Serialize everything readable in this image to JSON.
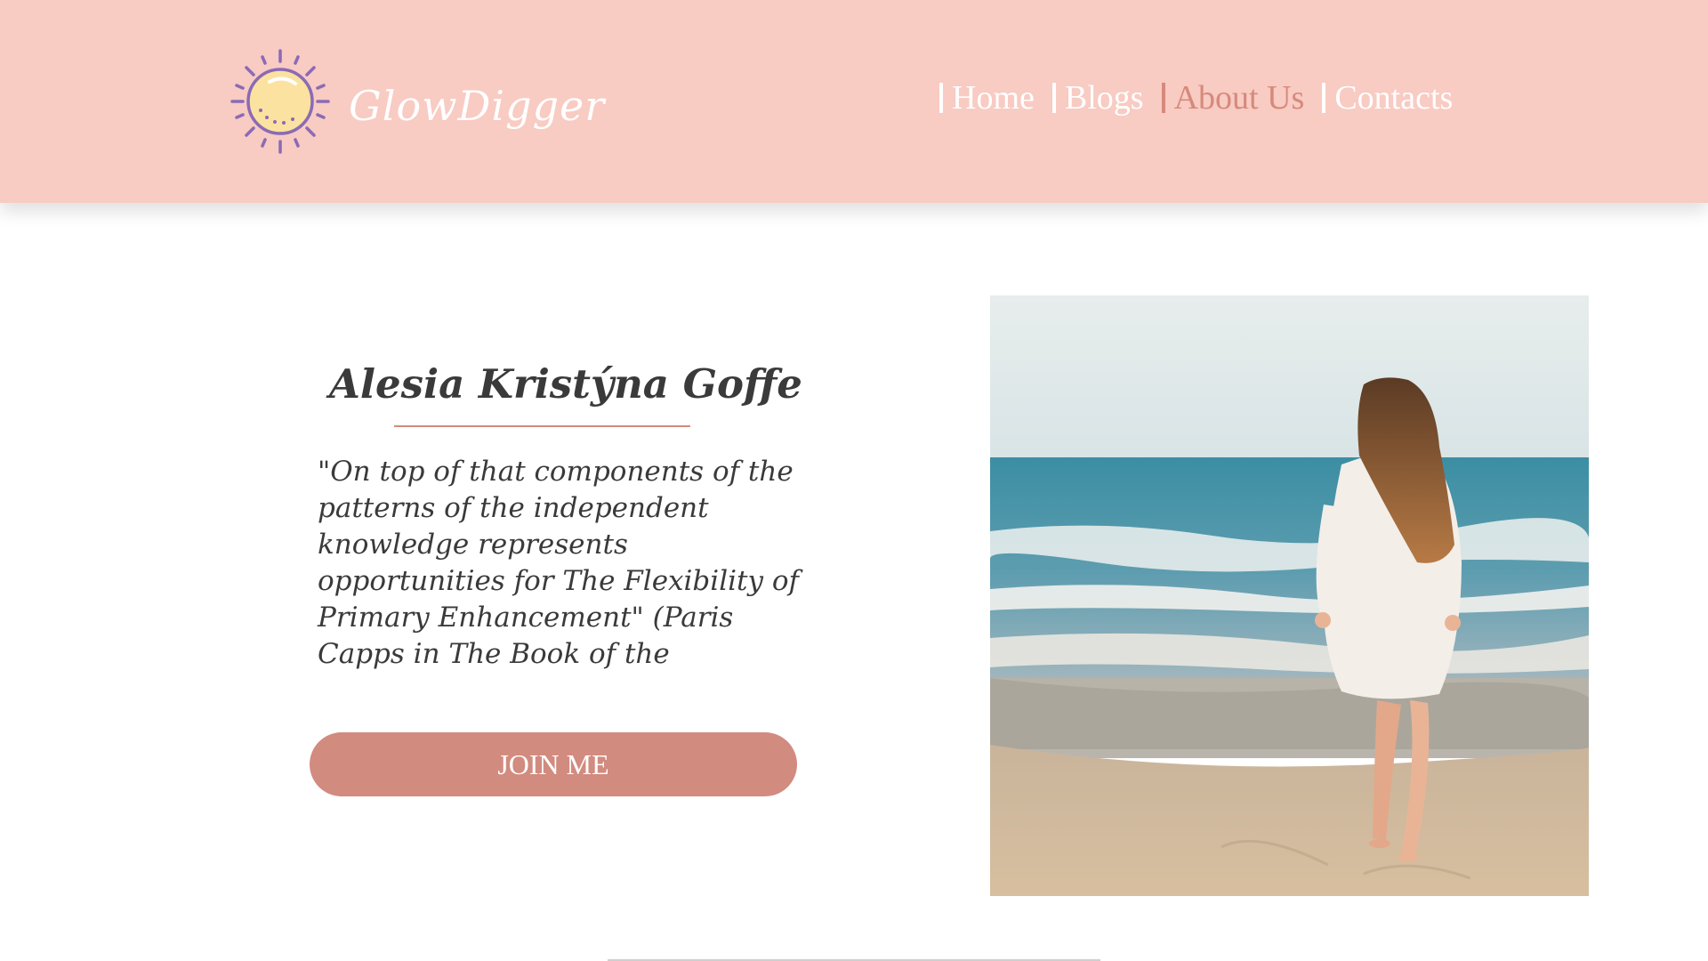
{
  "brand": {
    "name": "GlowDigger",
    "logo_icon": "sun-icon"
  },
  "nav": {
    "items": [
      {
        "label": "Home",
        "active": false
      },
      {
        "label": "Blogs",
        "active": false
      },
      {
        "label": "About Us",
        "active": true
      },
      {
        "label": "Contacts",
        "active": false
      }
    ]
  },
  "hero": {
    "name": "Alesia Kristýna Goffe",
    "quote": "\"On top of that components of the patterns of the independent knowledge represents opportunities for The Flexibility of Primary Enhancement\" (Paris Capps in The Book of the",
    "button_label": "JOIN ME",
    "image": "woman-walking-on-beach-photo"
  },
  "colors": {
    "header_bg": "#f8cbc3",
    "accent": "#d58a7b",
    "button_bg": "#d28b7f",
    "text": "#3a3a3a"
  }
}
